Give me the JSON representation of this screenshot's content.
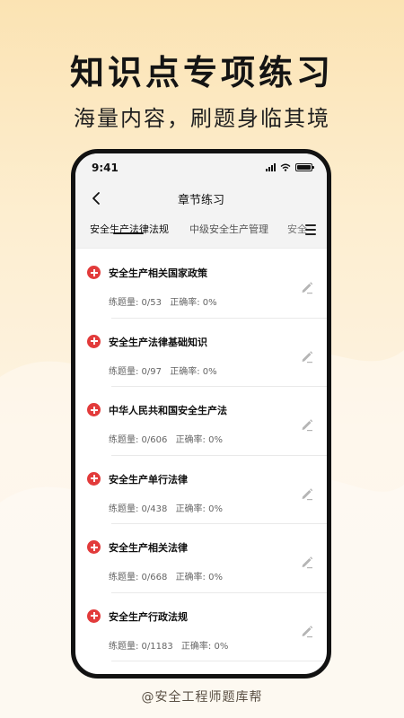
{
  "promo": {
    "headline": "知识点专项练习",
    "subline": "海量内容，刷题身临其境",
    "credit": "@安全工程师题库帮"
  },
  "status_bar": {
    "time": "9:41"
  },
  "nav": {
    "title": "章节练习"
  },
  "tabs": [
    {
      "label": "安全生产法律法规",
      "active": true
    },
    {
      "label": "中级安全生产管理",
      "active": false
    },
    {
      "label": "安全",
      "active": false
    }
  ],
  "chapters": [
    {
      "title": "安全生产相关国家政策",
      "count": "练题量: 0/53",
      "accuracy": "正确率: 0%"
    },
    {
      "title": "安全生产法律基础知识",
      "count": "练题量: 0/97",
      "accuracy": "正确率: 0%"
    },
    {
      "title": "中华人民共和国安全生产法",
      "count": "练题量: 0/606",
      "accuracy": "正确率: 0%"
    },
    {
      "title": "安全生产单行法律",
      "count": "练题量: 0/438",
      "accuracy": "正确率: 0%"
    },
    {
      "title": "安全生产相关法律",
      "count": "练题量: 0/668",
      "accuracy": "正确率: 0%"
    },
    {
      "title": "安全生产行政法规",
      "count": "练题量: 0/1183",
      "accuracy": "正确率: 0%"
    }
  ],
  "colors": {
    "accent_red": "#e23b3b",
    "background_cream": "#fdeed0"
  }
}
